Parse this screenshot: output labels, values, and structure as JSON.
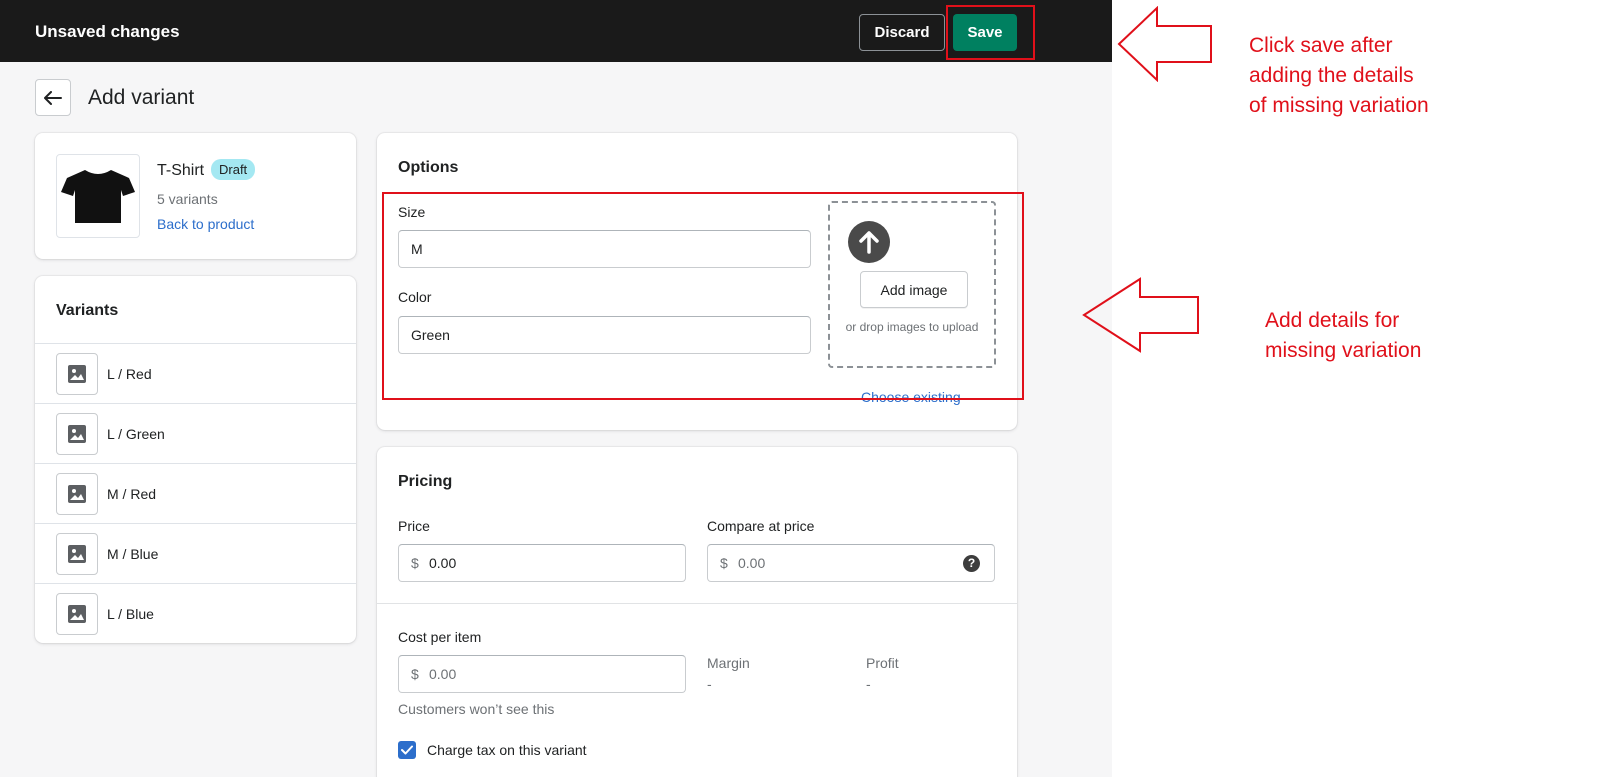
{
  "topbar": {
    "title": "Unsaved changes",
    "discard_label": "Discard",
    "save_label": "Save"
  },
  "page": {
    "title": "Add variant"
  },
  "product": {
    "name": "T-Shirt",
    "status_badge": "Draft",
    "variants_count": "5 variants",
    "back_link": "Back to product"
  },
  "variants": {
    "title": "Variants",
    "items": [
      {
        "label": "L / Red"
      },
      {
        "label": "L / Green"
      },
      {
        "label": "M / Red"
      },
      {
        "label": "M / Blue"
      },
      {
        "label": "L / Blue"
      }
    ]
  },
  "options": {
    "title": "Options",
    "size_label": "Size",
    "size_value": "M",
    "color_label": "Color",
    "color_value": "Green",
    "add_image_label": "Add image",
    "drop_hint": "or drop images to upload",
    "choose_existing": "Choose existing"
  },
  "pricing": {
    "title": "Pricing",
    "currency": "$",
    "price_label": "Price",
    "price_value": "0.00",
    "compare_label": "Compare at price",
    "compare_placeholder": "0.00",
    "cost_label": "Cost per item",
    "cost_placeholder": "0.00",
    "cost_help": "Customers won’t see this",
    "margin_label": "Margin",
    "margin_value": "-",
    "profit_label": "Profit",
    "profit_value": "-",
    "charge_tax_label": "Charge tax on this variant",
    "charge_tax_checked": true
  },
  "annotations": {
    "save_note": "Click save after\nadding the details\nof missing variation",
    "details_note": "Add details for\nmissing variation"
  },
  "colors": {
    "accent": "#e0101a",
    "save": "#008060",
    "link": "#2c6ecb",
    "topbar": "#1a1a1a",
    "badge": "#a4e8f2"
  },
  "icons": [
    "arrow-left-icon",
    "tshirt-icon",
    "image-placeholder-icon",
    "upload-arrow-icon",
    "question-icon",
    "checkmark-icon",
    "hollow-arrow-left-icon"
  ]
}
